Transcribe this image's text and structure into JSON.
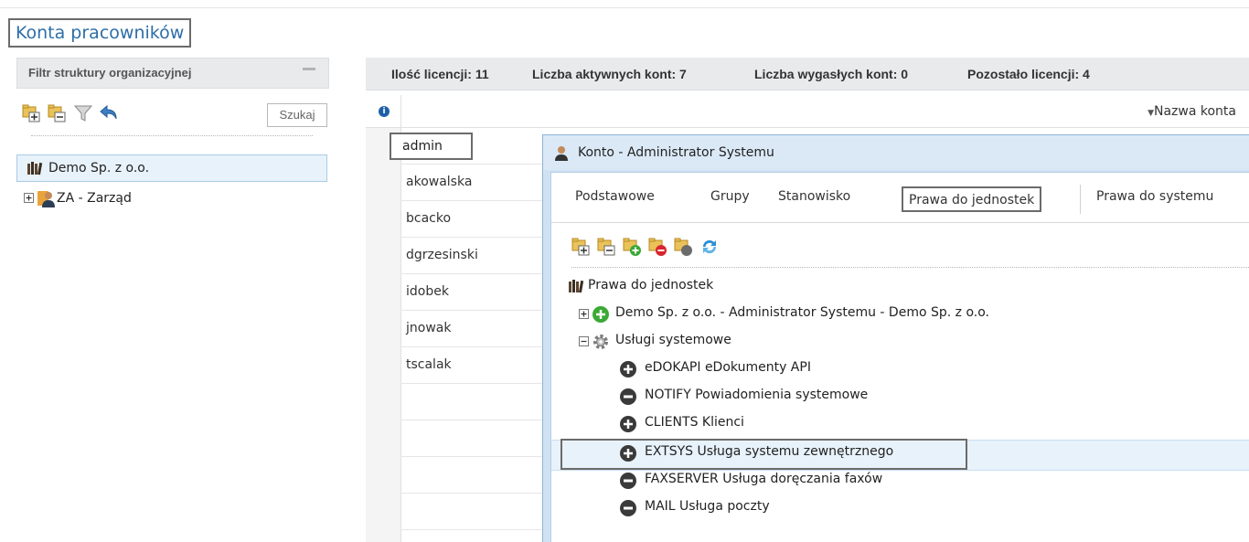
{
  "page": {
    "title": "Konta pracowników"
  },
  "left_panel": {
    "title": "Filtr struktury organizacyjnej",
    "toolbar": {
      "icons": [
        "expand-all-icon",
        "collapse-all-icon",
        "filter-icon",
        "undo-icon"
      ],
      "search_label": "Szukaj"
    },
    "tree": {
      "root": {
        "label": "Demo Sp. z o.o.",
        "icon": "books-icon"
      },
      "children": [
        {
          "label": "ZA - Zarząd",
          "icon": "manager-icon"
        }
      ]
    }
  },
  "stats": {
    "licenses": "Ilość licencji: 11",
    "active": "Liczba aktywnych kont: 7",
    "expired": "Liczba wygasłych kont: 0",
    "remaining": "Pozostało licencji: 4"
  },
  "grid": {
    "sort_column": "Nazwa konta",
    "rows": [
      "admin",
      "akowalska",
      "bcacko",
      "dgrzesinski",
      "idobek",
      "jnowak",
      "tscalak"
    ],
    "selected": "admin"
  },
  "dialog": {
    "title": "Konto - Administrator Systemu",
    "tabs": [
      "Podstawowe",
      "Grupy",
      "Stanowisko",
      "Prawa do jednostek",
      "Prawa do systemu"
    ],
    "active_tab": "Prawa do jednostek",
    "toolbar": {
      "icons": [
        "expand-all-icon",
        "collapse-all-icon",
        "add-green-icon",
        "remove-red-icon",
        "neutral-gray-icon",
        "refresh-icon"
      ]
    },
    "tree": {
      "root": "Prawa do jednostek",
      "demo": "Demo Sp. z o.o. - Administrator Systemu - Demo Sp. z o.o.",
      "services": "Usługi systemowe",
      "items": [
        {
          "label": "eDOKAPI eDokumenty API",
          "state": "plus"
        },
        {
          "label": "NOTIFY Powiadomienia systemowe",
          "state": "minus"
        },
        {
          "label": "CLIENTS Klienci",
          "state": "plus"
        },
        {
          "label": "EXTSYS Usługa systemu zewnętrznego",
          "state": "plus"
        },
        {
          "label": "FAXSERVER Usługa doręczania faxów",
          "state": "minus"
        },
        {
          "label": "MAIL Usługa poczty",
          "state": "minus"
        }
      ]
    }
  },
  "colors": {
    "accent": "#2d6ea8",
    "panel_header": "#e9eaec",
    "selection": "#e8f2fb",
    "selection_border": "#a9cbe6",
    "dialog_title": "#dbe9f7",
    "green": "#3aa935",
    "red": "#d8262e"
  }
}
